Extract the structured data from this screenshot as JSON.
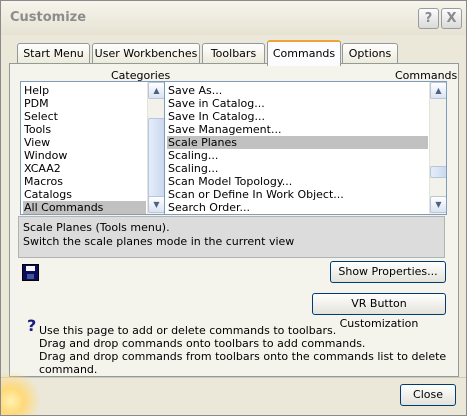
{
  "window": {
    "title": "Customize",
    "help_glyph": "?",
    "close_glyph": "X"
  },
  "tabs": [
    {
      "label": "Start Menu",
      "active": false
    },
    {
      "label": "User Workbenches",
      "active": false
    },
    {
      "label": "Toolbars",
      "active": false
    },
    {
      "label": "Commands",
      "active": true
    },
    {
      "label": "Options",
      "active": false
    }
  ],
  "categories": {
    "heading": "Categories",
    "items": [
      "Help",
      "PDM",
      "Select",
      "Tools",
      "View",
      "Window",
      "XCAA2",
      "Macros",
      "Catalogs",
      "All Commands"
    ],
    "selected": "All Commands"
  },
  "commands": {
    "heading": "Commands",
    "items": [
      "Save As...",
      "Save in Catalog...",
      "Save In Catalog...",
      "Save Management...",
      "Scale Planes",
      "Scaling...",
      "Scaling...",
      "Scan Model Topology...",
      "Scan or Define In Work Object...",
      "Search Order..."
    ],
    "selected": "Scale Planes"
  },
  "scroll_glyphs": {
    "up": "▲",
    "down": "▼"
  },
  "description": {
    "line1": "Scale Planes (Tools menu).",
    "line2": "Switch the scale planes mode in the current view"
  },
  "buttons": {
    "show_properties": "Show Properties...",
    "vr_customization": "VR Button Customization",
    "close": "Close"
  },
  "help": {
    "glyph": "?",
    "line1": "Use this page to add or delete commands to toolbars.",
    "line2": "Drag and drop commands onto toolbars to add commands.",
    "line3": "Drag and drop commands from toolbars onto the commands list to delete command."
  },
  "colors": {
    "selection": "#c1c1c1",
    "active_tab_accent": "#f0a23a",
    "button_border": "#003c74"
  },
  "icons": {
    "save": "floppy-disk-icon",
    "help": "question-mark-icon"
  }
}
